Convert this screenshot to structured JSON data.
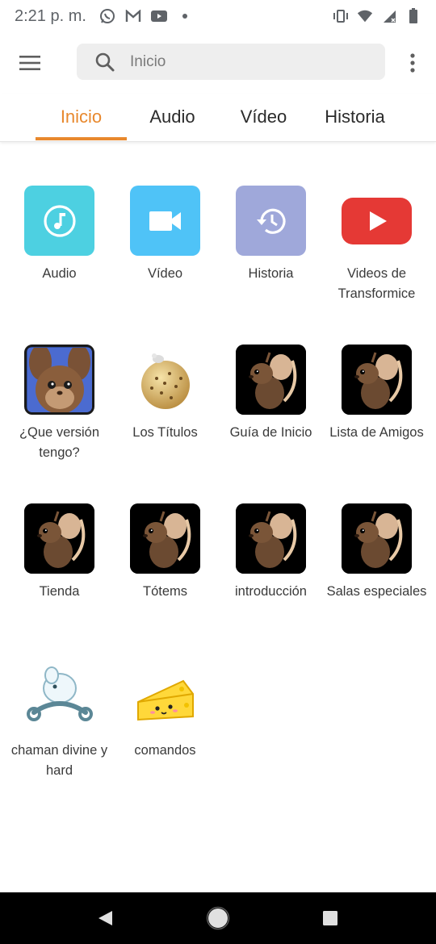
{
  "status": {
    "time": "2:21 p. m.",
    "left_icons": [
      "whatsapp-icon",
      "gmail-icon",
      "youtube-icon",
      "dot-icon"
    ],
    "right_icons": [
      "vibrate-icon",
      "wifi-icon",
      "signal-icon",
      "battery-icon"
    ]
  },
  "appbar": {
    "search_placeholder": "Inicio"
  },
  "tabs": [
    {
      "label": "Inicio",
      "active": true
    },
    {
      "label": "Audio",
      "active": false
    },
    {
      "label": "Vídeo",
      "active": false
    },
    {
      "label": "Historia",
      "active": false
    }
  ],
  "grid": [
    {
      "label": "Audio",
      "icon": "music-note-icon"
    },
    {
      "label": "Vídeo",
      "icon": "video-camera-icon"
    },
    {
      "label": "Historia",
      "icon": "history-icon"
    },
    {
      "label": "Videos de Transformice",
      "icon": "youtube-play-icon"
    },
    {
      "label": "¿Que versión tengo?",
      "icon": "mouse-portrait-icon"
    },
    {
      "label": "Los Títulos",
      "icon": "cheese-ball-icon"
    },
    {
      "label": "Guía de Inicio",
      "icon": "mouse-icon"
    },
    {
      "label": "Lista de Amigos",
      "icon": "mouse-icon"
    },
    {
      "label": "Tienda",
      "icon": "mouse-icon"
    },
    {
      "label": "Tótems",
      "icon": "mouse-icon"
    },
    {
      "label": "introducción",
      "icon": "mouse-icon"
    },
    {
      "label": "Salas especiales",
      "icon": "mouse-icon"
    },
    {
      "label": "chaman divine y hard",
      "icon": "shaman-mouse-icon"
    },
    {
      "label": "comandos",
      "icon": "cheese-icon"
    }
  ],
  "colors": {
    "accent": "#e8882d",
    "audio_tile": "#4dd0e1",
    "video_tile": "#4fc3f7",
    "history_tile": "#9fa8da",
    "youtube_red": "#e53935"
  }
}
